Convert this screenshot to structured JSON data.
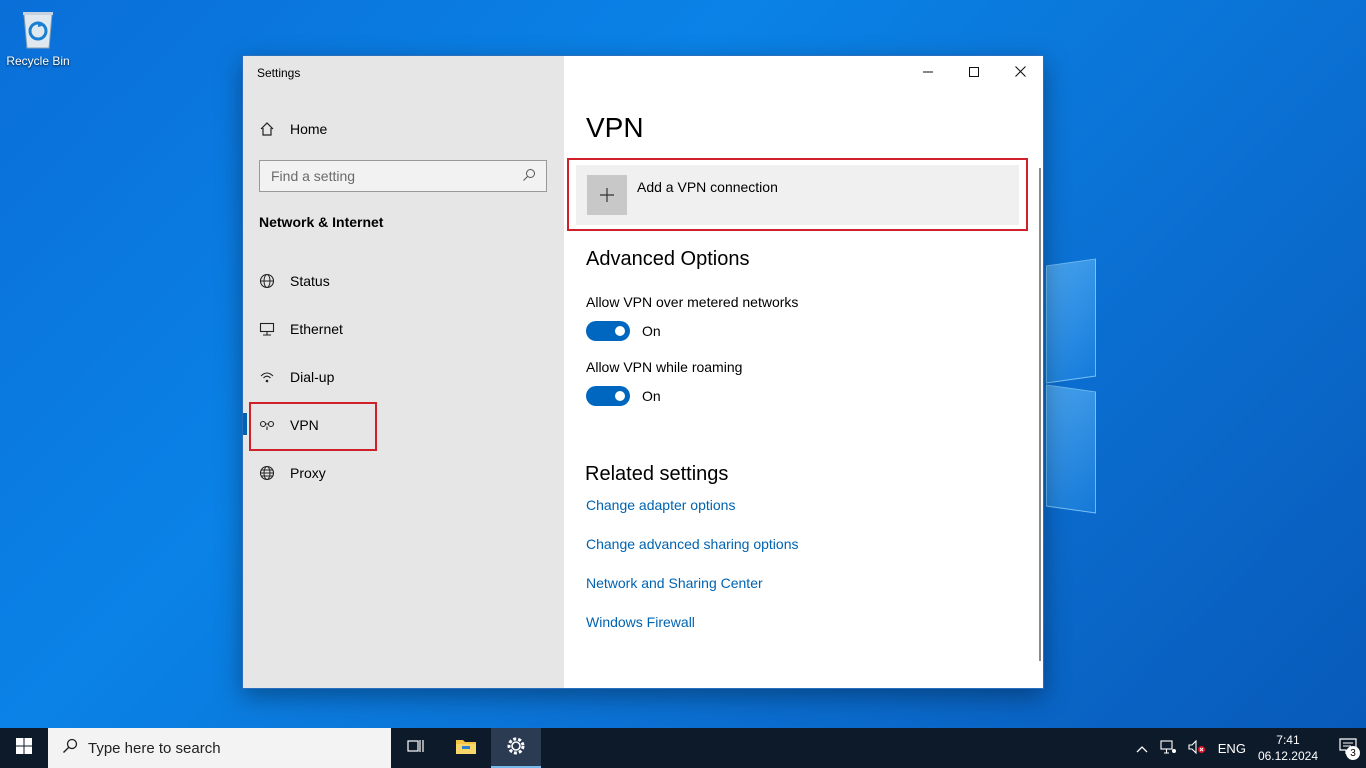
{
  "desktop": {
    "recycle_bin_label": "Recycle Bin"
  },
  "window": {
    "title": "Settings",
    "minimize_icon": "minimize-icon",
    "maximize_icon": "maximize-icon",
    "close_icon": "close-icon"
  },
  "sidebar": {
    "home_label": "Home",
    "search_placeholder": "Find a setting",
    "section_title": "Network & Internet",
    "items": [
      {
        "label": "Status",
        "icon": "globe-status-icon"
      },
      {
        "label": "Ethernet",
        "icon": "ethernet-icon"
      },
      {
        "label": "Dial-up",
        "icon": "dialup-icon"
      },
      {
        "label": "VPN",
        "icon": "vpn-icon",
        "selected": true
      },
      {
        "label": "Proxy",
        "icon": "globe-icon"
      }
    ]
  },
  "main": {
    "page_title": "VPN",
    "add_vpn_label": "Add a VPN connection",
    "advanced_title": "Advanced Options",
    "options": [
      {
        "label": "Allow VPN over metered networks",
        "state": "On",
        "on": true
      },
      {
        "label": "Allow VPN while roaming",
        "state": "On",
        "on": true
      }
    ],
    "related_title": "Related settings",
    "related_links": [
      "Change adapter options",
      "Change advanced sharing options",
      "Network and Sharing Center",
      "Windows Firewall"
    ]
  },
  "taskbar": {
    "search_placeholder": "Type here to search",
    "language": "ENG",
    "time": "7:41",
    "date": "06.12.2024",
    "notification_count": "3"
  },
  "colors": {
    "accent": "#0067c0",
    "link": "#0063b1",
    "highlight": "#d0202a"
  }
}
